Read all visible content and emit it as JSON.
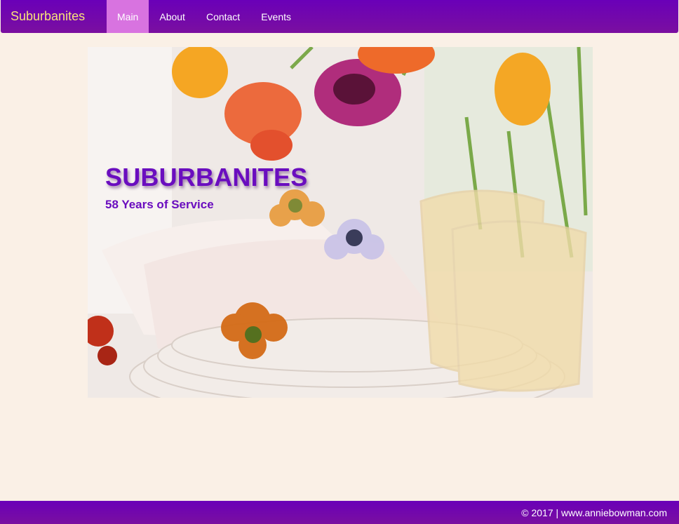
{
  "navbar": {
    "brand": "Suburbanites",
    "items": [
      {
        "label": "Main",
        "active": true
      },
      {
        "label": "About",
        "active": false
      },
      {
        "label": "Contact",
        "active": false
      },
      {
        "label": "Events",
        "active": false
      }
    ]
  },
  "hero": {
    "title": "SUBURBANITES",
    "subtitle": "58 Years of Service",
    "image": "table-setting-with-tulips"
  },
  "footer": {
    "text": "© 2017 | www.anniebowman.com"
  },
  "colors": {
    "nav_bg": "#6a00b8",
    "nav_active": "#d873e0",
    "brand_text": "#f7e27a",
    "page_bg": "#faf0e6",
    "title_text": "#6a0dbf"
  }
}
